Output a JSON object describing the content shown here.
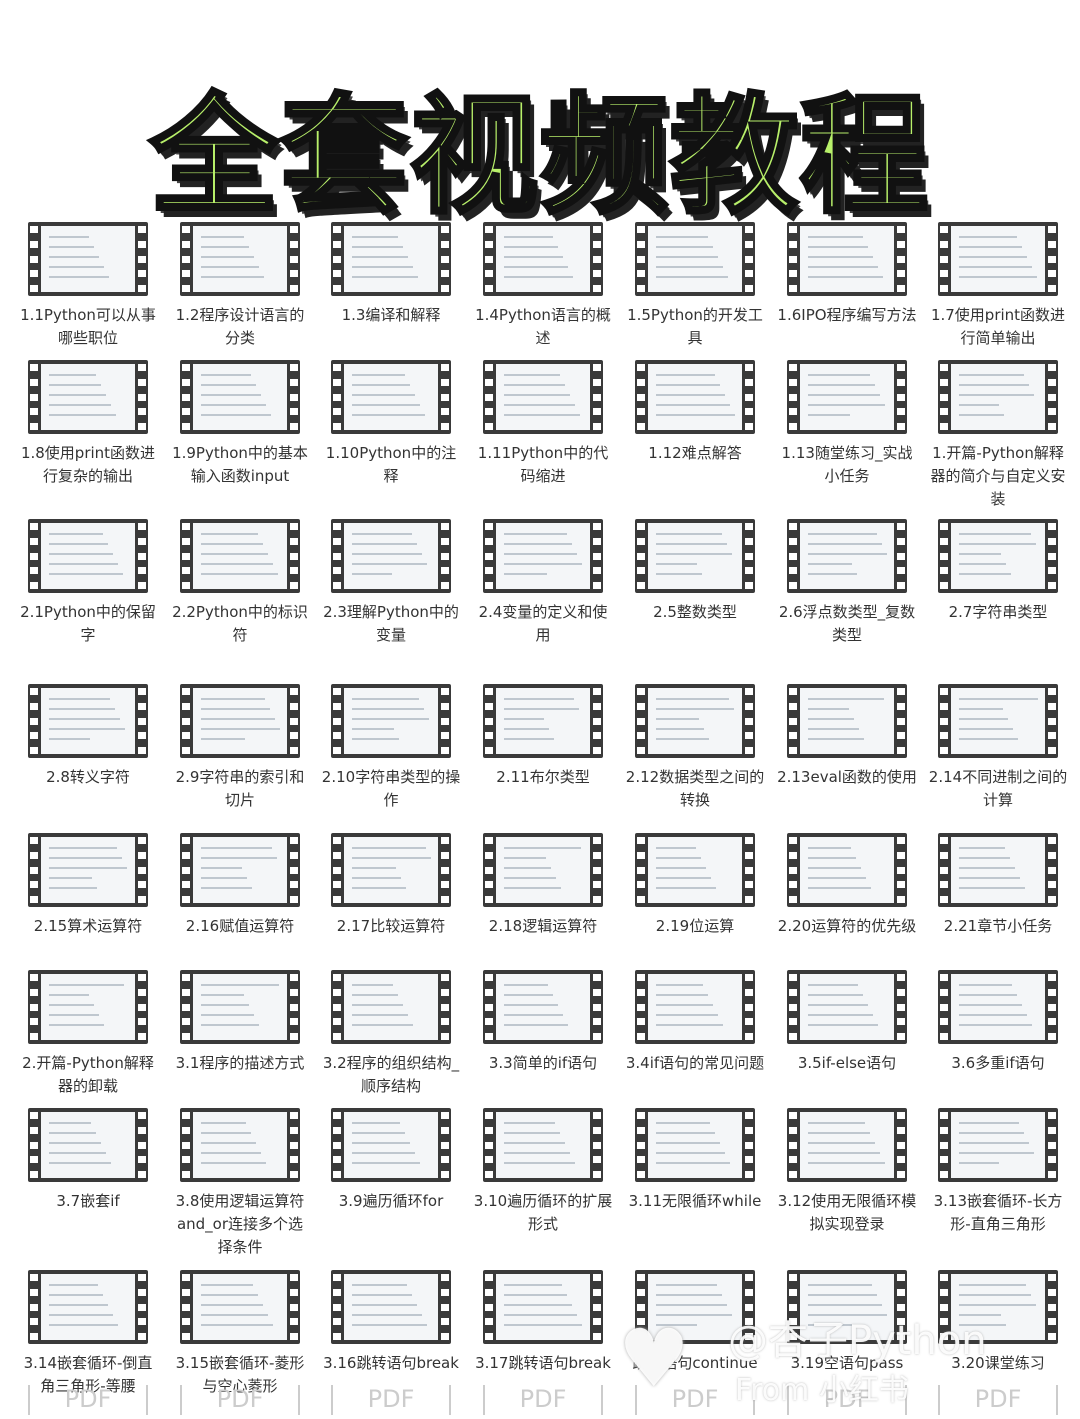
{
  "title": "全套视频教程",
  "accent_color": "#b8f06a",
  "watermark": {
    "handle": "@杏子Python",
    "source": "From 小红书",
    "icon": "heart-icon"
  },
  "pdf_label": "PDF",
  "rows": [
    [
      "1.1Python可以从事哪些职位",
      "1.2程序设计语言的分类",
      "1.3编译和解释",
      "1.4Python语言的概述",
      "1.5Python的开发工具",
      "1.6IPO程序编写方法",
      "1.7使用print函数进行简单输出"
    ],
    [
      "1.8使用print函数进行复杂的输出",
      "1.9Python中的基本输入函数input",
      "1.10Python中的注释",
      "1.11Python中的代码缩进",
      "1.12难点解答",
      "1.13随堂练习_实战小任务",
      "1.开篇-Python解释器的简介与自定义安装"
    ],
    [
      "2.1Python中的保留字",
      "2.2Python中的标识符",
      "2.3理解Python中的变量",
      "2.4变量的定义和使用",
      "2.5整数类型",
      "2.6浮点数类型_复数类型",
      "2.7字符串类型"
    ],
    [
      "2.8转义字符",
      "2.9字符串的索引和切片",
      "2.10字符串类型的操作",
      "2.11布尔类型",
      "2.12数据类型之间的转换",
      "2.13eval函数的使用",
      "2.14不同进制之间的计算"
    ],
    [
      "2.15算术运算符",
      "2.16赋值运算符",
      "2.17比较运算符",
      "2.18逻辑运算符",
      "2.19位运算",
      "2.20运算符的优先级",
      "2.21章节小任务"
    ],
    [
      "2.开篇-Python解释器的卸载",
      "3.1程序的描述方式",
      "3.2程序的组织结构_顺序结构",
      "3.3简单的if语句",
      "3.4if语句的常见问题",
      "3.5if-else语句",
      "3.6多重if语句"
    ],
    [
      "3.7嵌套if",
      "3.8使用逻辑运算符and_or连接多个选择条件",
      "3.9遍历循环for",
      "3.10遍历循环的扩展形式",
      "3.11无限循环while",
      "3.12使用无限循环模拟实现登录",
      "3.13嵌套循环-长方形-直角三角形"
    ],
    [
      "3.14嵌套循环-倒直角三角形-等腰",
      "3.15嵌套循环-菱形与空心菱形",
      "3.16跳转语句break",
      "3.17跳转语句break",
      "跳转语句continue",
      "3.19空语句pass",
      "3.20课堂练习"
    ]
  ]
}
